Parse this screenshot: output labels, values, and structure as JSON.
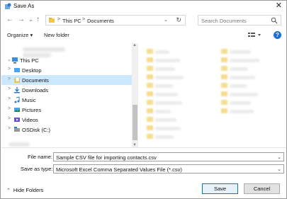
{
  "window": {
    "title": "Save As",
    "close_glyph": "✕"
  },
  "nav": {
    "back": "←",
    "forward": "→",
    "recent": "⌄",
    "up": "↑"
  },
  "address": {
    "segments": [
      "This PC",
      "Documents"
    ],
    "separator": ">",
    "dropdown": "⌄",
    "refresh": "↻"
  },
  "search": {
    "placeholder": "Search Documents"
  },
  "toolbar": {
    "organize_label": "Organize ▾",
    "new_folder_label": "New folder",
    "help_glyph": "?"
  },
  "tree": {
    "items": [
      {
        "label": "This PC",
        "icon": "pc-icon",
        "chevron": "⌄",
        "selected": false
      },
      {
        "label": "Desktop",
        "icon": "desktop-folder-icon",
        "chevron": ">",
        "selected": false
      },
      {
        "label": "Documents",
        "icon": "documents-folder-icon",
        "chevron": ">",
        "selected": true
      },
      {
        "label": "Downloads",
        "icon": "downloads-folder-icon",
        "chevron": ">",
        "selected": false
      },
      {
        "label": "Music",
        "icon": "music-folder-icon",
        "chevron": ">",
        "selected": false
      },
      {
        "label": "Pictures",
        "icon": "pictures-folder-icon",
        "chevron": ">",
        "selected": false
      },
      {
        "label": "Videos",
        "icon": "videos-folder-icon",
        "chevron": ">",
        "selected": false
      },
      {
        "label": "OSDisk (C:)",
        "icon": "disk-drive-icon",
        "chevron": ">",
        "selected": false
      }
    ]
  },
  "form": {
    "file_name_label": "File name:",
    "file_name_value": "Sample CSV file for importing contacts.csv",
    "save_type_label": "Save as type:",
    "save_type_value": "Microsoft Excel Comma Separated Values File (*.csv)",
    "dropdown_glyph": "⌄"
  },
  "footer": {
    "hide_folders_label": "Hide Folders",
    "hide_glyph": "⌃",
    "save_label": "Save",
    "cancel_label": "Cancel"
  },
  "colors": {
    "accent": "#0078d7",
    "selection": "#cce8ff",
    "folder": "#f5c842"
  }
}
